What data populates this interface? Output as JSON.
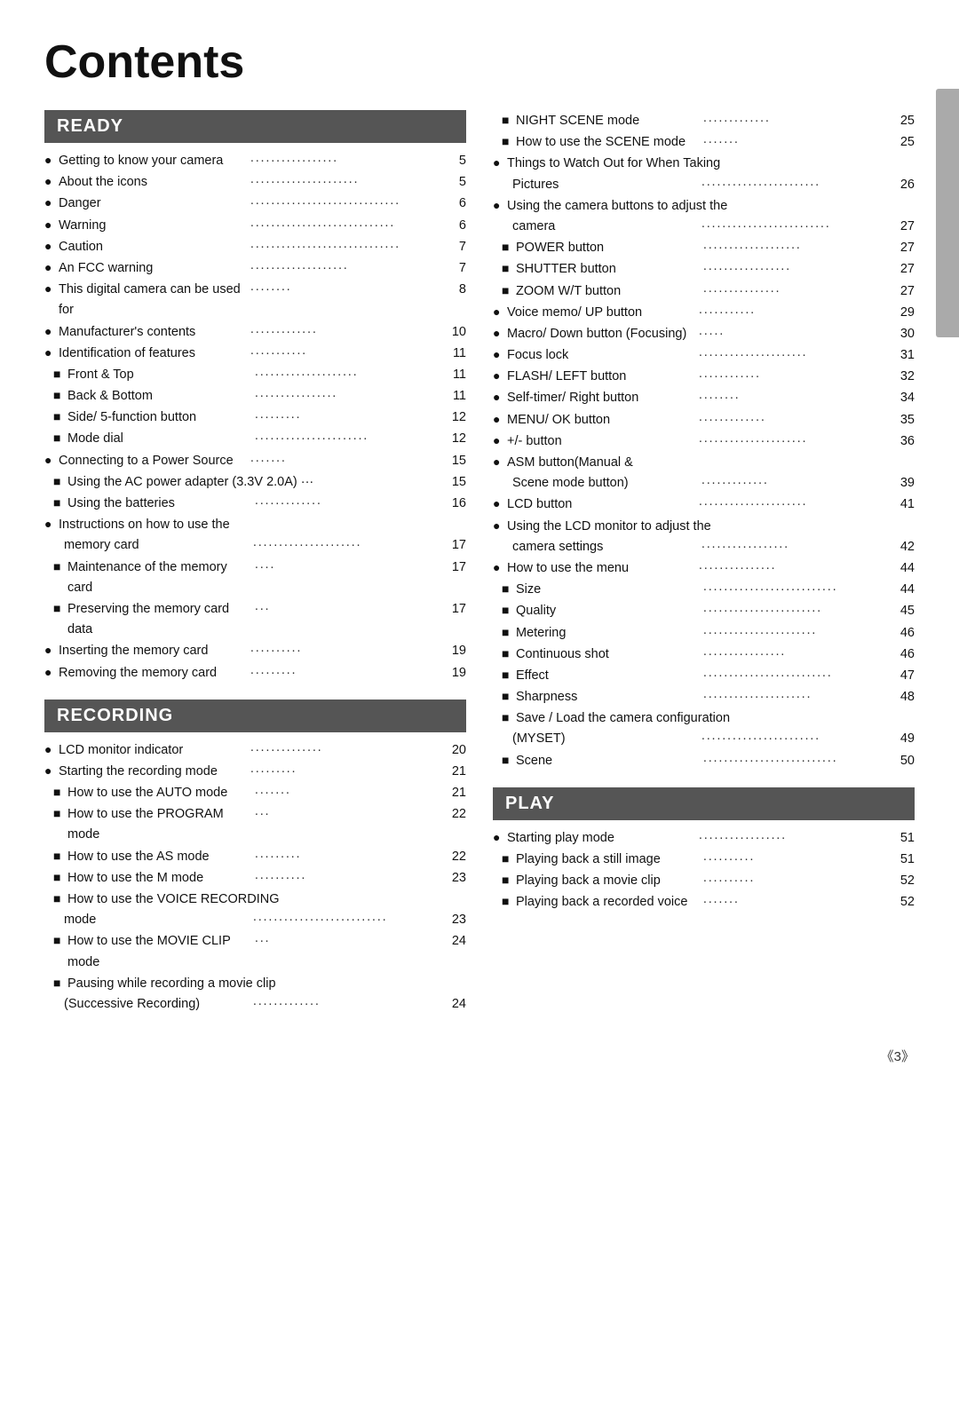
{
  "title": "Contents",
  "sections": {
    "ready": {
      "label": "READY",
      "items": [
        {
          "bullet": "circle",
          "text": "Getting to know your camera",
          "dots": true,
          "page": "5"
        },
        {
          "bullet": "circle",
          "text": "About the icons",
          "dots": true,
          "page": "5"
        },
        {
          "bullet": "circle",
          "text": "Danger",
          "dots": true,
          "page": "6"
        },
        {
          "bullet": "circle",
          "text": "Warning",
          "dots": true,
          "page": "6"
        },
        {
          "bullet": "circle",
          "text": "Caution",
          "dots": true,
          "page": "7"
        },
        {
          "bullet": "circle",
          "text": "An FCC warning",
          "dots": true,
          "page": "7"
        },
        {
          "bullet": "circle",
          "text": "This digital camera can be used for",
          "dots": true,
          "page": "8"
        },
        {
          "bullet": "circle",
          "text": "Manufacturer's contents",
          "dots": true,
          "page": "10"
        },
        {
          "bullet": "circle",
          "text": "Identification of features",
          "dots": true,
          "page": "11"
        },
        {
          "bullet": "square",
          "text": "Front & Top",
          "dots": true,
          "page": "11"
        },
        {
          "bullet": "square",
          "text": "Back & Bottom",
          "dots": true,
          "page": "11"
        },
        {
          "bullet": "square",
          "text": "Side/ 5-function button",
          "dots": true,
          "page": "12"
        },
        {
          "bullet": "square",
          "text": "Mode dial",
          "dots": true,
          "page": "12"
        },
        {
          "bullet": "circle",
          "text": "Connecting to a Power Source",
          "dots": true,
          "page": "15"
        },
        {
          "bullet": "square",
          "text": "Using the AC power adapter (3.3V 2.0A)",
          "dots": false,
          "page": "15",
          "prefix": "···"
        },
        {
          "bullet": "square",
          "text": "Using the batteries",
          "dots": true,
          "page": "16"
        },
        {
          "bullet": "circle",
          "text": "Instructions on how to use the"
        },
        {
          "bullet": "none",
          "text": "memory card",
          "dots": true,
          "page": "17",
          "sub": true
        },
        {
          "bullet": "square",
          "text": "Maintenance of the memory card",
          "dots": true,
          "page": "17"
        },
        {
          "bullet": "square",
          "text": "Preserving the memory card data",
          "dots": true,
          "page": "17"
        },
        {
          "bullet": "circle",
          "text": "Inserting the memory card",
          "dots": true,
          "page": "19"
        },
        {
          "bullet": "circle",
          "text": "Removing the memory card",
          "dots": true,
          "page": "19"
        }
      ]
    },
    "recording": {
      "label": "RECORDING",
      "items": [
        {
          "bullet": "circle",
          "text": "LCD monitor indicator",
          "dots": true,
          "page": "20"
        },
        {
          "bullet": "circle",
          "text": "Starting the recording mode",
          "dots": true,
          "page": "21"
        },
        {
          "bullet": "square",
          "text": "How to use the AUTO mode",
          "dots": true,
          "page": "21"
        },
        {
          "bullet": "square",
          "text": "How to use the PROGRAM mode",
          "dots": true,
          "page": "22"
        },
        {
          "bullet": "square",
          "text": "How to use the AS mode",
          "dots": true,
          "page": "22"
        },
        {
          "bullet": "square",
          "text": "How to use the M mode",
          "dots": true,
          "page": "23"
        },
        {
          "bullet": "square",
          "text": "How to use the VOICE RECORDING"
        },
        {
          "bullet": "none",
          "text": "mode",
          "dots": true,
          "page": "23",
          "sub": true
        },
        {
          "bullet": "square",
          "text": "How to use the MOVIE CLIP mode",
          "dots": true,
          "page": "24"
        },
        {
          "bullet": "square",
          "text": "Pausing while recording a movie clip"
        },
        {
          "bullet": "none",
          "text": "(Successive Recording)",
          "dots": true,
          "page": "24",
          "sub": true
        }
      ]
    }
  },
  "right_col": {
    "items_top": [
      {
        "bullet": "square",
        "text": "NIGHT SCENE mode",
        "dots": true,
        "page": "25"
      },
      {
        "bullet": "square",
        "text": "How to use the SCENE mode",
        "dots": true,
        "page": "25"
      },
      {
        "bullet": "circle",
        "text": "Things to Watch Out for When Taking"
      },
      {
        "bullet": "none",
        "text": "Pictures",
        "dots": true,
        "page": "26",
        "sub": true
      },
      {
        "bullet": "circle",
        "text": "Using the camera buttons to adjust the"
      },
      {
        "bullet": "none",
        "text": "camera",
        "dots": true,
        "page": "27",
        "sub": true
      },
      {
        "bullet": "square",
        "text": "POWER button",
        "dots": true,
        "page": "27"
      },
      {
        "bullet": "square",
        "text": "SHUTTER button",
        "dots": true,
        "page": "27"
      },
      {
        "bullet": "square",
        "text": "ZOOM W/T button",
        "dots": true,
        "page": "27"
      },
      {
        "bullet": "circle",
        "text": "Voice memo/ UP button",
        "dots": true,
        "page": "29"
      },
      {
        "bullet": "circle",
        "text": "Macro/ Down button (Focusing)",
        "dots": true,
        "page": "30"
      },
      {
        "bullet": "circle",
        "text": "Focus lock",
        "dots": true,
        "page": "31"
      },
      {
        "bullet": "circle",
        "text": "FLASH/ LEFT button",
        "dots": true,
        "page": "32"
      },
      {
        "bullet": "circle",
        "text": "Self-timer/ Right button",
        "dots": true,
        "page": "34"
      },
      {
        "bullet": "circle",
        "text": "MENU/ OK button",
        "dots": true,
        "page": "35"
      },
      {
        "bullet": "circle",
        "text": "+/- button",
        "dots": true,
        "page": "36"
      },
      {
        "bullet": "circle",
        "text": "ASM button(Manual &"
      },
      {
        "bullet": "none",
        "text": "Scene mode button)",
        "dots": true,
        "page": "39",
        "sub": true
      },
      {
        "bullet": "circle",
        "text": "LCD button",
        "dots": true,
        "page": "41"
      },
      {
        "bullet": "circle",
        "text": "Using the LCD monitor to adjust the"
      },
      {
        "bullet": "none",
        "text": "camera settings",
        "dots": true,
        "page": "42",
        "sub": true
      },
      {
        "bullet": "circle",
        "text": "How to use the menu",
        "dots": true,
        "page": "44"
      },
      {
        "bullet": "square",
        "text": "Size",
        "dots": true,
        "page": "44"
      },
      {
        "bullet": "square",
        "text": "Quality",
        "dots": true,
        "page": "45"
      },
      {
        "bullet": "square",
        "text": "Metering",
        "dots": true,
        "page": "46"
      },
      {
        "bullet": "square",
        "text": "Continuous shot",
        "dots": true,
        "page": "46"
      },
      {
        "bullet": "square",
        "text": "Effect",
        "dots": true,
        "page": "47"
      },
      {
        "bullet": "square",
        "text": "Sharpness",
        "dots": true,
        "page": "48"
      },
      {
        "bullet": "square",
        "text": "Save / Load the camera configuration"
      },
      {
        "bullet": "none",
        "text": "(MYSET)",
        "dots": true,
        "page": "49",
        "sub": true
      },
      {
        "bullet": "square",
        "text": "Scene",
        "dots": true,
        "page": "50"
      }
    ],
    "play": {
      "label": "PLAY",
      "items": [
        {
          "bullet": "circle",
          "text": "Starting play mode",
          "dots": true,
          "page": "51"
        },
        {
          "bullet": "square",
          "text": "Playing back a still image",
          "dots": true,
          "page": "51"
        },
        {
          "bullet": "square",
          "text": "Playing back a movie clip",
          "dots": true,
          "page": "52"
        },
        {
          "bullet": "square",
          "text": "Playing back a recorded voice",
          "dots": true,
          "page": "52"
        }
      ]
    }
  },
  "footer": {
    "page": "《3》"
  }
}
